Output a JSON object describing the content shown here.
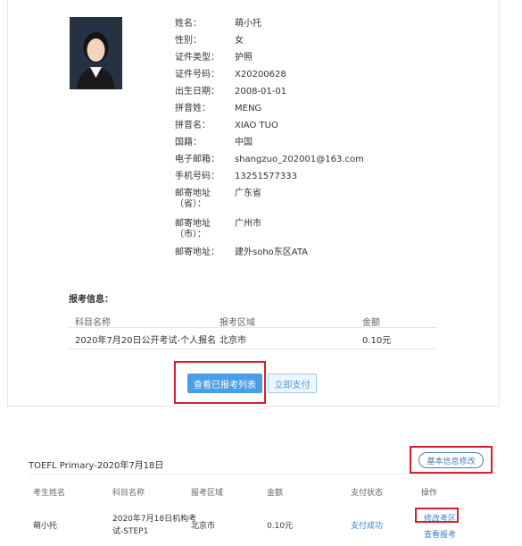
{
  "profile": {
    "photo_icon": "person-photo",
    "fields": [
      {
        "label": "姓名：",
        "value": "萌小托"
      },
      {
        "label": "性别：",
        "value": "女"
      },
      {
        "label": "证件类型：",
        "value": "护照"
      },
      {
        "label": "证件号码：",
        "value": "X20200628"
      },
      {
        "label": "出生日期：",
        "value": "2008-01-01"
      },
      {
        "label": "拼音姓：",
        "value": "MENG"
      },
      {
        "label": "拼音名：",
        "value": "XIAO TUO"
      },
      {
        "label": "国籍：",
        "value": "中国"
      },
      {
        "label": "电子邮箱：",
        "value": "shangzuo_202001@163.com"
      },
      {
        "label": "手机号码：",
        "value": "13251577333"
      },
      {
        "label": "邮寄地址\n（省）：",
        "value": "广东省"
      },
      {
        "label": "邮寄地址\n（市）：",
        "value": "广州市"
      },
      {
        "label": "邮寄地址：",
        "value": "建外soho东区ATA"
      }
    ]
  },
  "registration": {
    "title": "报考信息：",
    "headers": [
      "科目名称",
      "报考区域",
      "金额"
    ],
    "row": [
      "2020年7月20日公开考试-个人报名",
      "北京市",
      "0.10元"
    ],
    "view_list_button": "查看已报考列表",
    "pay_button": "立即支付"
  },
  "exam_card": {
    "title": "TOEFL Primary-2020年7月18日",
    "edit_button": "基本信息修改",
    "headers": [
      "考生姓名",
      "科目名称",
      "报考区域",
      "金额",
      "支付状态",
      "操作"
    ],
    "row": {
      "name": "萌小托",
      "subject_line1": "2020年7月18日机构考",
      "subject_line2": "试-STEP1",
      "region": "北京市",
      "amount": "0.10元",
      "status": "支付成功",
      "action_edit": "修改考区",
      "action_view": "查看报考"
    }
  },
  "colors": {
    "primary": "#4a9de6",
    "highlight_box": "#d9202a",
    "link": "#3b82d0"
  }
}
